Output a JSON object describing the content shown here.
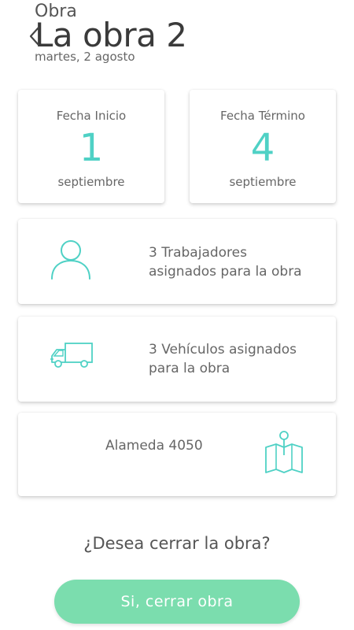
{
  "header": {
    "breadcrumb": "Obra",
    "title": "La obra 2",
    "date": "martes, 2 agosto",
    "back_icon": "chevron-left-icon"
  },
  "dates": {
    "start": {
      "label": "Fecha Inicio",
      "day": "1",
      "month": "septiembre"
    },
    "end": {
      "label": "Fecha Término",
      "day": "4",
      "month": "septiembre"
    }
  },
  "workers": {
    "icon": "person-icon",
    "line1": "3 Trabajadores",
    "line2": "asignados para la obra"
  },
  "vehicles": {
    "icon": "truck-icon",
    "line1": "3 Vehículos asignados",
    "line2": "para la obra"
  },
  "address": {
    "icon": "map-icon",
    "text": "Alameda 4050"
  },
  "footer": {
    "question": "¿Desea cerrar la obra?",
    "button_label": "Si, cerrar obra"
  },
  "colors": {
    "accent": "#4fd1c5",
    "button": "#7bddae",
    "text": "#555555"
  }
}
